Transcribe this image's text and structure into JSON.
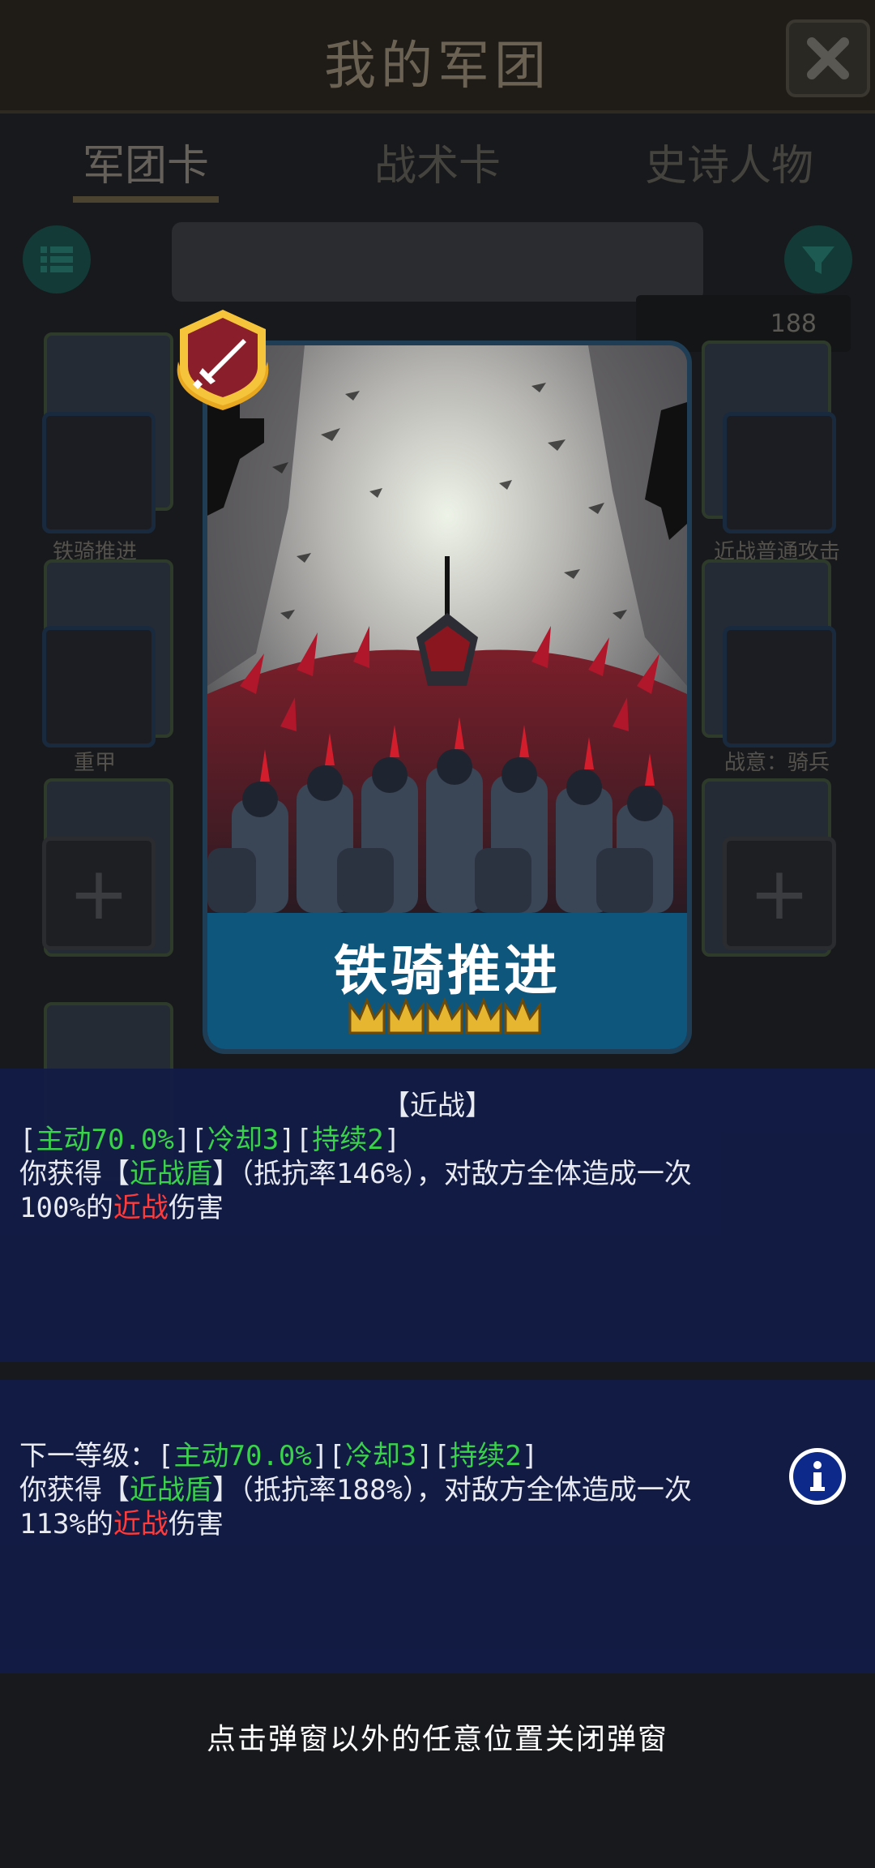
{
  "background": {
    "title": "我的军团",
    "tabs": [
      "军团卡",
      "战术卡",
      "史诗人物"
    ],
    "counter": "188",
    "card_names": [
      "铁骑推进",
      "近战普通攻击",
      "重甲",
      "战意：骑兵"
    ]
  },
  "card": {
    "name": "铁骑推进",
    "crown_count": 5
  },
  "current": {
    "category": "【近战】",
    "tags": {
      "b1": "[",
      "active": "主动70.0%",
      "b2": "][",
      "cooldown": "冷却3",
      "b3": "][",
      "duration": "持续2",
      "b4": "]"
    },
    "line1": {
      "a": "你获得【",
      "shield": "近战盾",
      "b": "】（抵抗率146%），对敌方全体造成一次"
    },
    "line2": {
      "a": "100%的",
      "type": "近战",
      "b": "伤害"
    }
  },
  "next": {
    "tags": {
      "prefix": "下一等级：[",
      "active": "主动70.0%",
      "b2": "][",
      "cooldown": "冷却3",
      "b3": "][",
      "duration": "持续2",
      "b4": "]"
    },
    "line1": {
      "a": "你获得【",
      "shield": "近战盾",
      "b": "】（抵抗率188%），对敌方全体造成一次"
    },
    "line2": {
      "a": "113%的",
      "type": "近战",
      "b": "伤害"
    }
  },
  "hint": "点击弹窗以外的任意位置关闭弹窗",
  "colors": {
    "highlight_green": "#39d24a",
    "highlight_red": "#ff3b3b",
    "panel_bg": "#121c46",
    "card_plate": "#0f567c"
  },
  "icons": [
    "close-icon",
    "list-icon",
    "filter-icon",
    "info-icon",
    "melee-sword-badge-icon",
    "crown-icon"
  ]
}
